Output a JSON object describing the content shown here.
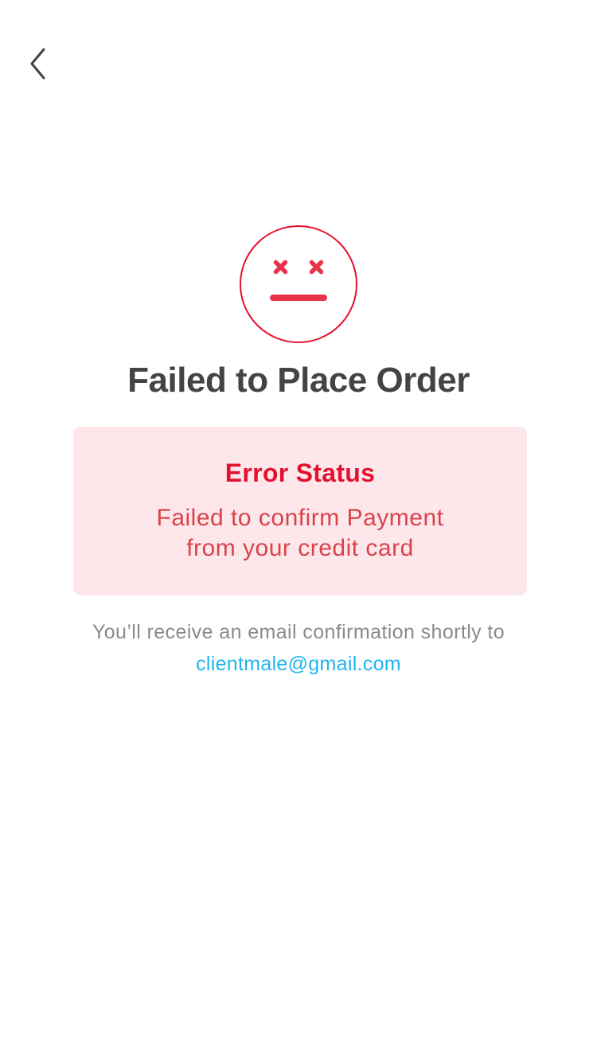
{
  "header": {
    "back_icon": "chevron-left-icon"
  },
  "status_icon": "error-face-icon",
  "colors": {
    "accent_red": "#e4112e",
    "face_red": "#e8334a",
    "card_background": "#fde7ea",
    "title_text": "#444444",
    "muted_text": "#8a8a8a",
    "link_blue": "#1fb4ef"
  },
  "page": {
    "title": "Failed to Place Order"
  },
  "error_card": {
    "heading": "Error Status",
    "message_line1": "Failed to confirm Payment",
    "message_line2": "from your credit card"
  },
  "confirmation": {
    "text": "You’ll receive an email confirmation shortly to",
    "email": "clientmale@gmail.com"
  }
}
